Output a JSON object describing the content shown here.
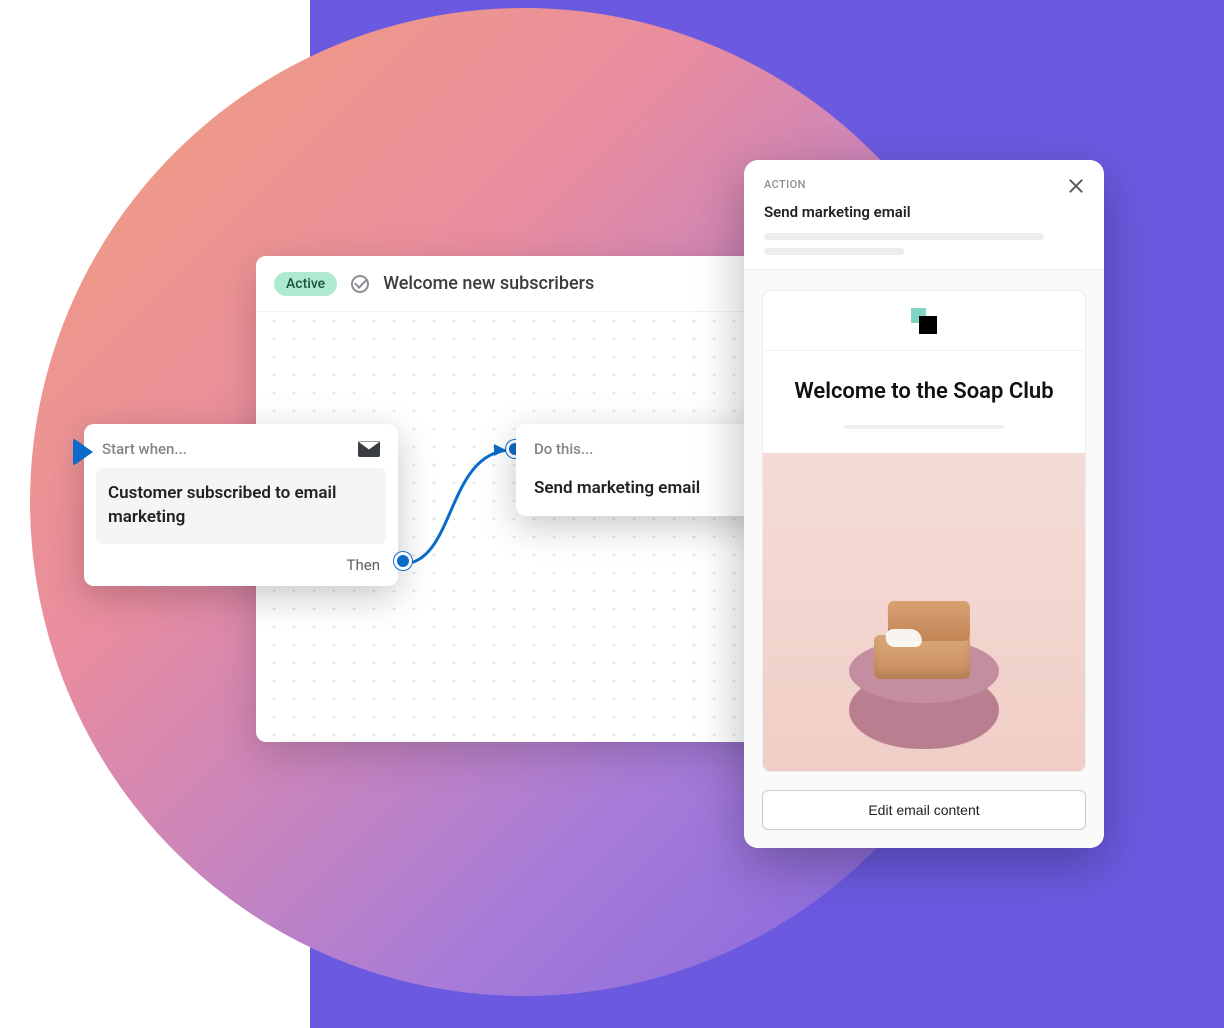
{
  "canvas": {
    "badge": "Active",
    "title": "Welcome new subscribers"
  },
  "trigger": {
    "header": "Start when...",
    "body": "Customer subscribed to email marketing",
    "footer": "Then"
  },
  "action": {
    "header": "Do this...",
    "body": "Send marketing email"
  },
  "panel": {
    "eyebrow": "ACTION",
    "title": "Send marketing email",
    "email_heading": "Welcome to the Soap Club",
    "button": "Edit email content"
  }
}
